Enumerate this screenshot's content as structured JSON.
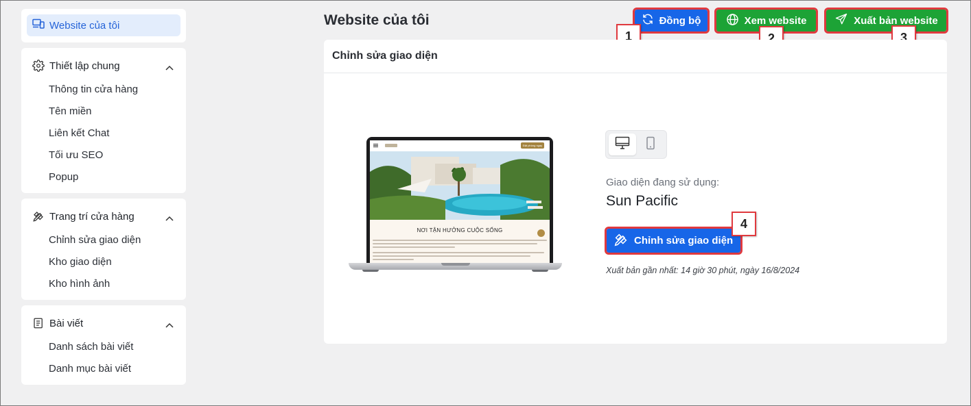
{
  "sidebar": {
    "active_item": {
      "label": "Website của tôi",
      "icon": "devices-icon"
    },
    "groups": [
      {
        "title": "Thiết lập chung",
        "icon": "gear-icon",
        "items": [
          "Thông tin cửa hàng",
          "Tên miền",
          "Liên kết Chat",
          "Tối ưu SEO",
          "Popup"
        ]
      },
      {
        "title": "Trang trí cửa hàng",
        "icon": "design-tools-icon",
        "items": [
          "Chỉnh sửa giao diện",
          "Kho giao diện",
          "Kho hình ảnh"
        ]
      },
      {
        "title": "Bài viết",
        "icon": "article-icon",
        "items": [
          "Danh sách bài viết",
          "Danh mục bài viết"
        ]
      }
    ]
  },
  "header": {
    "title": "Website của tôi",
    "buttons": {
      "sync": "Đồng bộ",
      "view": "Xem website",
      "publish": "Xuất bản website"
    }
  },
  "badges": [
    "1",
    "2",
    "3",
    "4"
  ],
  "panel": {
    "title": "Chỉnh sửa giao diện",
    "preview": {
      "cta": "Đặt phòng ngay",
      "heading": "NƠI TẬN HƯỞNG CUỘC SỐNG"
    },
    "theme_label": "Giao diện đang sử dụng:",
    "theme_name": "Sun Pacific",
    "edit_button": "Chỉnh sửa giao diện",
    "publish_note": "Xuất bản gần nhất: 14 giờ 30 phút, ngày 16/8/2024"
  },
  "colors": {
    "primary": "#1766e8",
    "success": "#1da336",
    "highlight": "#e0393e",
    "active_bg": "#e3edfc"
  }
}
